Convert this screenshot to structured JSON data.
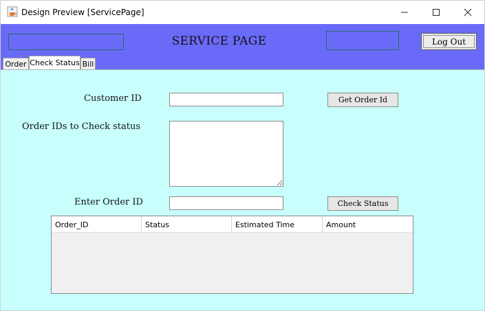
{
  "window": {
    "title": "Design Preview [ServicePage]",
    "icon": "java-cup-icon"
  },
  "header": {
    "title": "SERVICE PAGE",
    "logout_label": "Log Out",
    "background_color": "#6a6af8"
  },
  "tabs": [
    {
      "label": "Order",
      "selected": false
    },
    {
      "label": "Check Status",
      "selected": true
    },
    {
      "label": "Bill",
      "selected": false
    }
  ],
  "form": {
    "customer_id_label": "Customer ID",
    "customer_id_value": "",
    "order_ids_label": "Order IDs to Check status",
    "order_ids_value": "",
    "enter_order_label": "Enter Order ID",
    "enter_order_value": "",
    "get_order_button": "Get Order Id",
    "check_status_button": "Check Status",
    "panel_color": "#c8fffd"
  },
  "table": {
    "columns": [
      "Order_ID",
      "Status",
      "Estimated Time",
      "Amount"
    ],
    "rows": []
  }
}
